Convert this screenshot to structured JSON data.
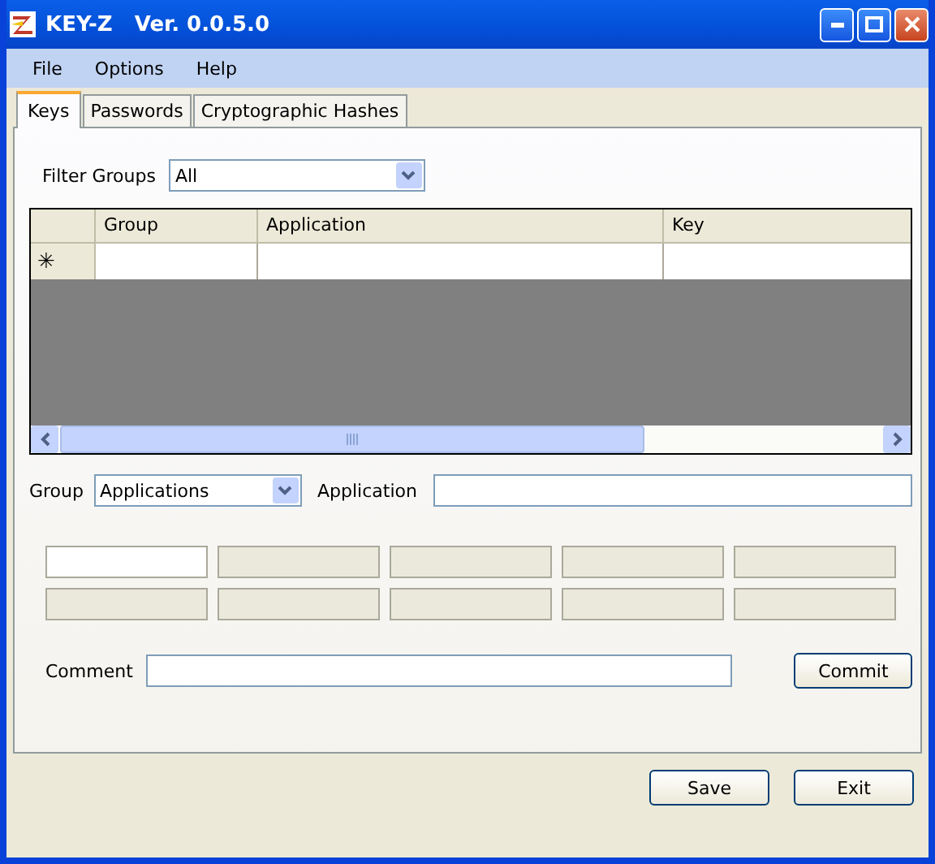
{
  "window": {
    "title": "KEY-Z   Ver. 0.0.5.0"
  },
  "menu": [
    "File",
    "Options",
    "Help"
  ],
  "tabs": [
    {
      "label": "Keys",
      "selected": true
    },
    {
      "label": "Passwords",
      "selected": false
    },
    {
      "label": "Cryptographic Hashes",
      "selected": false
    }
  ],
  "filter": {
    "label": "Filter Groups",
    "value": "All"
  },
  "table": {
    "columns": [
      "Group",
      "Application",
      "Key"
    ],
    "new_row_marker": "✳"
  },
  "group": {
    "label": "Group",
    "value": "Applications"
  },
  "application": {
    "label": "Application"
  },
  "key_fields": [
    {
      "disabled": false
    },
    {
      "disabled": true
    },
    {
      "disabled": true
    },
    {
      "disabled": true
    },
    {
      "disabled": true
    },
    {
      "disabled": true
    },
    {
      "disabled": true
    },
    {
      "disabled": true
    },
    {
      "disabled": true
    },
    {
      "disabled": true
    }
  ],
  "comment": {
    "label": "Comment"
  },
  "commit_button": "Commit",
  "buttons": [
    "Save",
    "Exit"
  ]
}
